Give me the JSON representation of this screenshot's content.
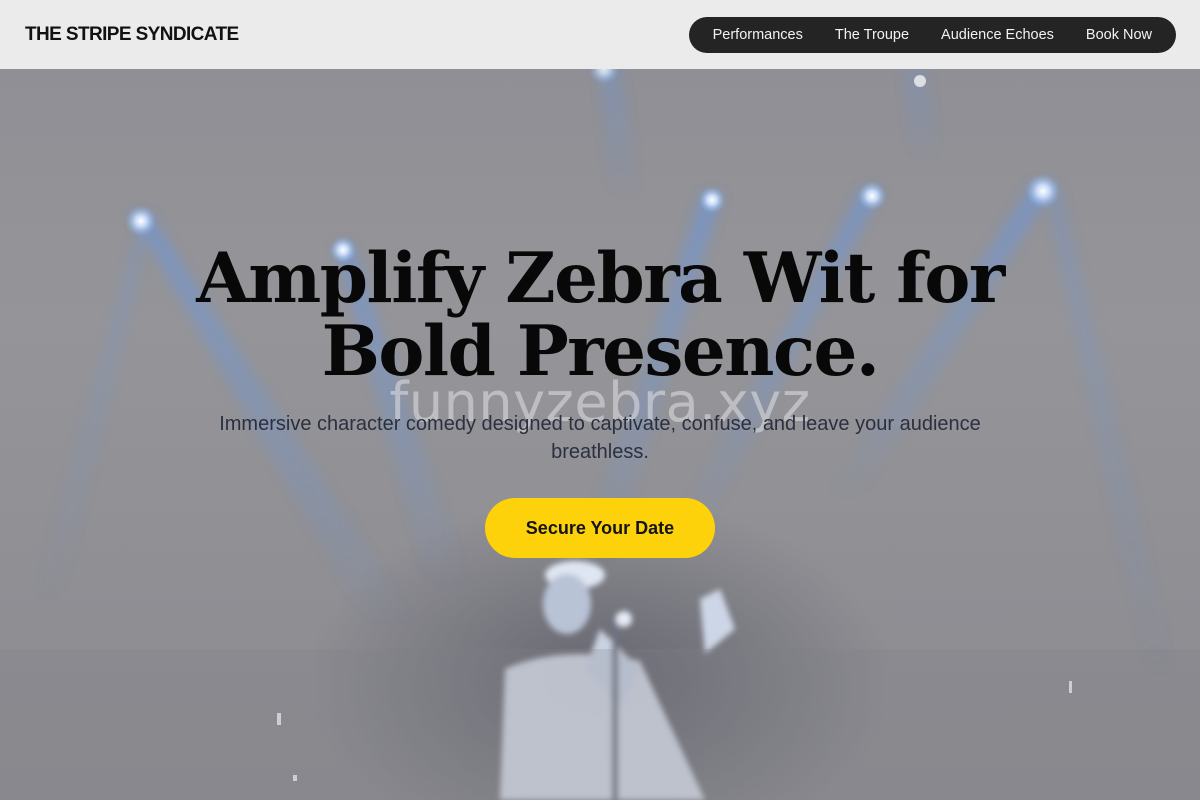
{
  "header": {
    "brand": "THE STRIPE SYNDICATE",
    "nav": [
      {
        "label": "Performances"
      },
      {
        "label": "The Troupe"
      },
      {
        "label": "Audience Echoes"
      },
      {
        "label": "Book Now"
      }
    ]
  },
  "hero": {
    "headline": "Amplify Zebra Wit for Bold Presence.",
    "subheadline": "Immersive character comedy designed to captivate, confuse, and leave your audience breathless.",
    "cta_label": "Secure Your Date",
    "watermark": "funnyzebra.xyz",
    "background_image": "comedian-on-stage-with-microphone-and-spotlights"
  },
  "colors": {
    "header_bg": "#ebebeb",
    "nav_bg": "#242424",
    "cta_bg": "#fdd20a",
    "overlay": "#8f8f95"
  }
}
